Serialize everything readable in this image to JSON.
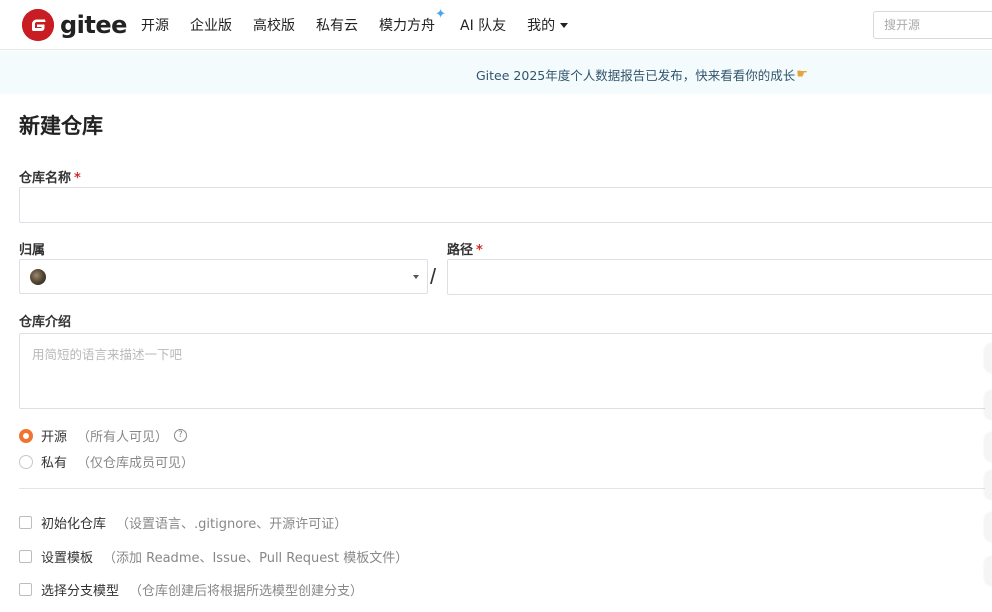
{
  "brand": {
    "name": "gitee",
    "logo_letter": "G",
    "color": "#c71d23"
  },
  "nav": {
    "items": [
      {
        "label": "开源"
      },
      {
        "label": "企业版"
      },
      {
        "label": "高校版"
      },
      {
        "label": "私有云"
      },
      {
        "label": "模力方舟"
      },
      {
        "label": "AI 队友"
      },
      {
        "label": "我的"
      }
    ],
    "search_placeholder": "搜开源"
  },
  "banner": {
    "text": "Gitee 2025年度个人数据报告已发布，快来看看你的成长"
  },
  "form": {
    "title": "新建仓库",
    "name_label": "仓库名称",
    "required_mark": "*",
    "owner_label": "归属",
    "path_label": "路径",
    "path_separator": "/",
    "desc_label": "仓库介绍",
    "desc_placeholder": "用简短的语言来描述一下吧",
    "visibility": {
      "public_label": "开源",
      "public_hint": "（所有人可见）",
      "private_label": "私有",
      "private_hint": "（仅仓库成员可见）",
      "selected": "public"
    },
    "options": [
      {
        "label": "初始化仓库",
        "hint": "（设置语言、.gitignore、开源许可证）",
        "checked": false
      },
      {
        "label": "设置模板",
        "hint": "（添加 Readme、Issue、Pull Request 模板文件）",
        "checked": false
      },
      {
        "label": "选择分支模型",
        "hint": "（仓库创建后将根据所选模型创建分支）",
        "checked": false
      }
    ]
  },
  "colors": {
    "accent": "#f0742d",
    "required": "#db2828",
    "banner_bg": "#f3fbfc"
  }
}
